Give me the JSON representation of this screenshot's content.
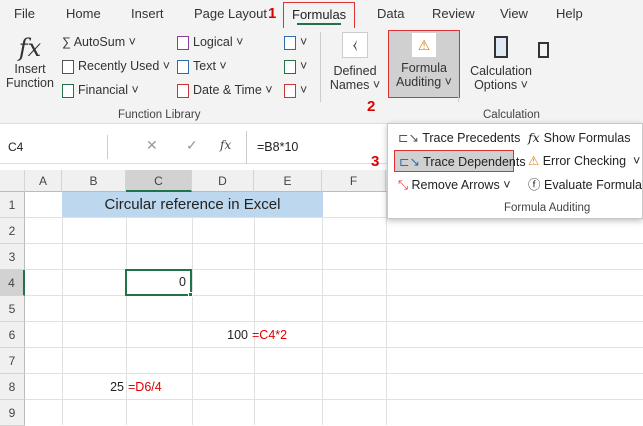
{
  "tabs": [
    "File",
    "Home",
    "Insert",
    "Page Layout",
    "Formulas",
    "Data",
    "Review",
    "View",
    "Help"
  ],
  "annotations": [
    "1",
    "2",
    "3"
  ],
  "ribbon": {
    "insert_function": [
      "Insert",
      "Function"
    ],
    "autosum": "AutoSum",
    "recently_used": "Recently Used",
    "financial": "Financial",
    "logical": "Logical",
    "text": "Text",
    "date_time": "Date & Time",
    "defined_names": [
      "Defined",
      "Names"
    ],
    "formula_auditing": [
      "Formula",
      "Auditing"
    ],
    "calc_options": [
      "Calculation",
      "Options"
    ],
    "groups": {
      "function_library": "Function Library",
      "calculation": "Calculation",
      "formula_auditing": "Formula Auditing"
    }
  },
  "auditing_menu": {
    "trace_precedents": "Trace Precedents",
    "trace_dependents": "Trace Dependents",
    "remove_arrows": "Remove Arrows",
    "show_formulas": "Show Formulas",
    "error_checking": "Error Checking",
    "evaluate_formula": "Evaluate Formula"
  },
  "formula_bar": {
    "name_box": "C4",
    "fx": "fx",
    "formula": "=B8*10"
  },
  "columns": [
    "A",
    "B",
    "C",
    "D",
    "E",
    "F"
  ],
  "rows": [
    "1",
    "2",
    "3",
    "4",
    "5",
    "6",
    "7",
    "8",
    "9"
  ],
  "cells": {
    "B1": "Circular reference in Excel",
    "C4": "0",
    "D6": "100",
    "E6": "=C4*2",
    "B8": "25",
    "C8": "=D6/4"
  },
  "colors": {
    "accent": "#217346",
    "title_fill": "#bdd7ee",
    "annotation": "#d00000",
    "formula_text": "#e00000"
  }
}
